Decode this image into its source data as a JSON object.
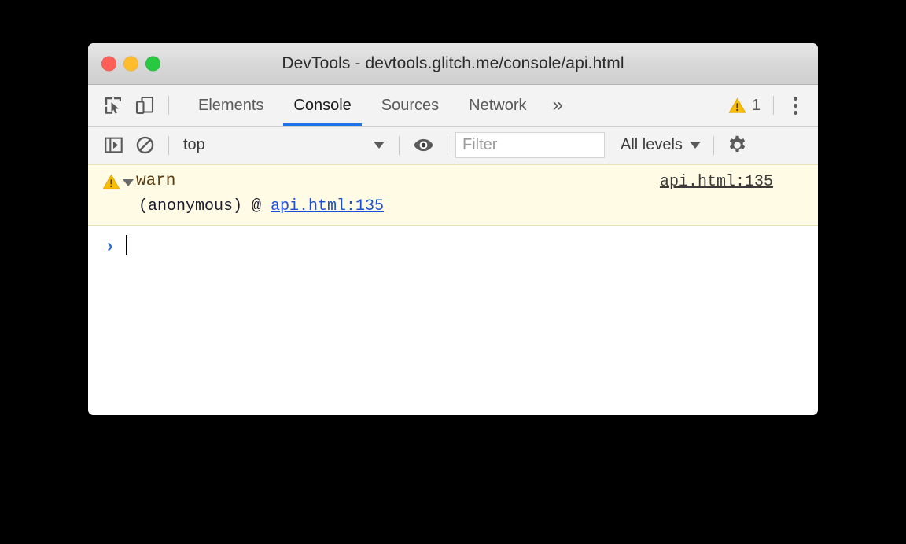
{
  "window": {
    "title": "DevTools - devtools.glitch.me/console/api.html",
    "traffic_lights": [
      {
        "name": "close",
        "color": "#ff5f56"
      },
      {
        "name": "minimize",
        "color": "#ffbd2e"
      },
      {
        "name": "maximize",
        "color": "#28c840"
      }
    ]
  },
  "tabbar": {
    "inspect_icon": "inspect-element-icon",
    "device_icon": "device-toolbar-icon",
    "tabs": [
      {
        "label": "Elements",
        "active": false
      },
      {
        "label": "Console",
        "active": true
      },
      {
        "label": "Sources",
        "active": false
      },
      {
        "label": "Network",
        "active": false
      }
    ],
    "more_tabs_label": "»",
    "warning_icon": "warning-triangle-icon",
    "warning_count": "1",
    "menu_icon": "kebab-menu-icon",
    "active_tab_accent": "#1a73e8"
  },
  "console_toolbar": {
    "sidebar_icon": "console-sidebar-toggle-icon",
    "clear_icon": "clear-console-icon",
    "context": {
      "value": "top",
      "caret": "▼"
    },
    "eye_icon": "live-expression-eye-icon",
    "filter": {
      "value": "",
      "placeholder": "Filter"
    },
    "levels": {
      "label": "All levels",
      "caret": "▼"
    },
    "settings_icon": "settings-gear-icon"
  },
  "console_messages": [
    {
      "type": "warning",
      "icon": "warning-triangle-icon",
      "disclosure": "expanded",
      "text": "warn",
      "source_link": "api.html:135",
      "stack_prefix": "(anonymous) @ ",
      "stack_link": "api.html:135",
      "background": "#fffbe5",
      "text_color": "#5c3c10"
    }
  ],
  "prompt": {
    "chevron": "›",
    "value": "",
    "chevron_color": "#2f6fd0"
  }
}
